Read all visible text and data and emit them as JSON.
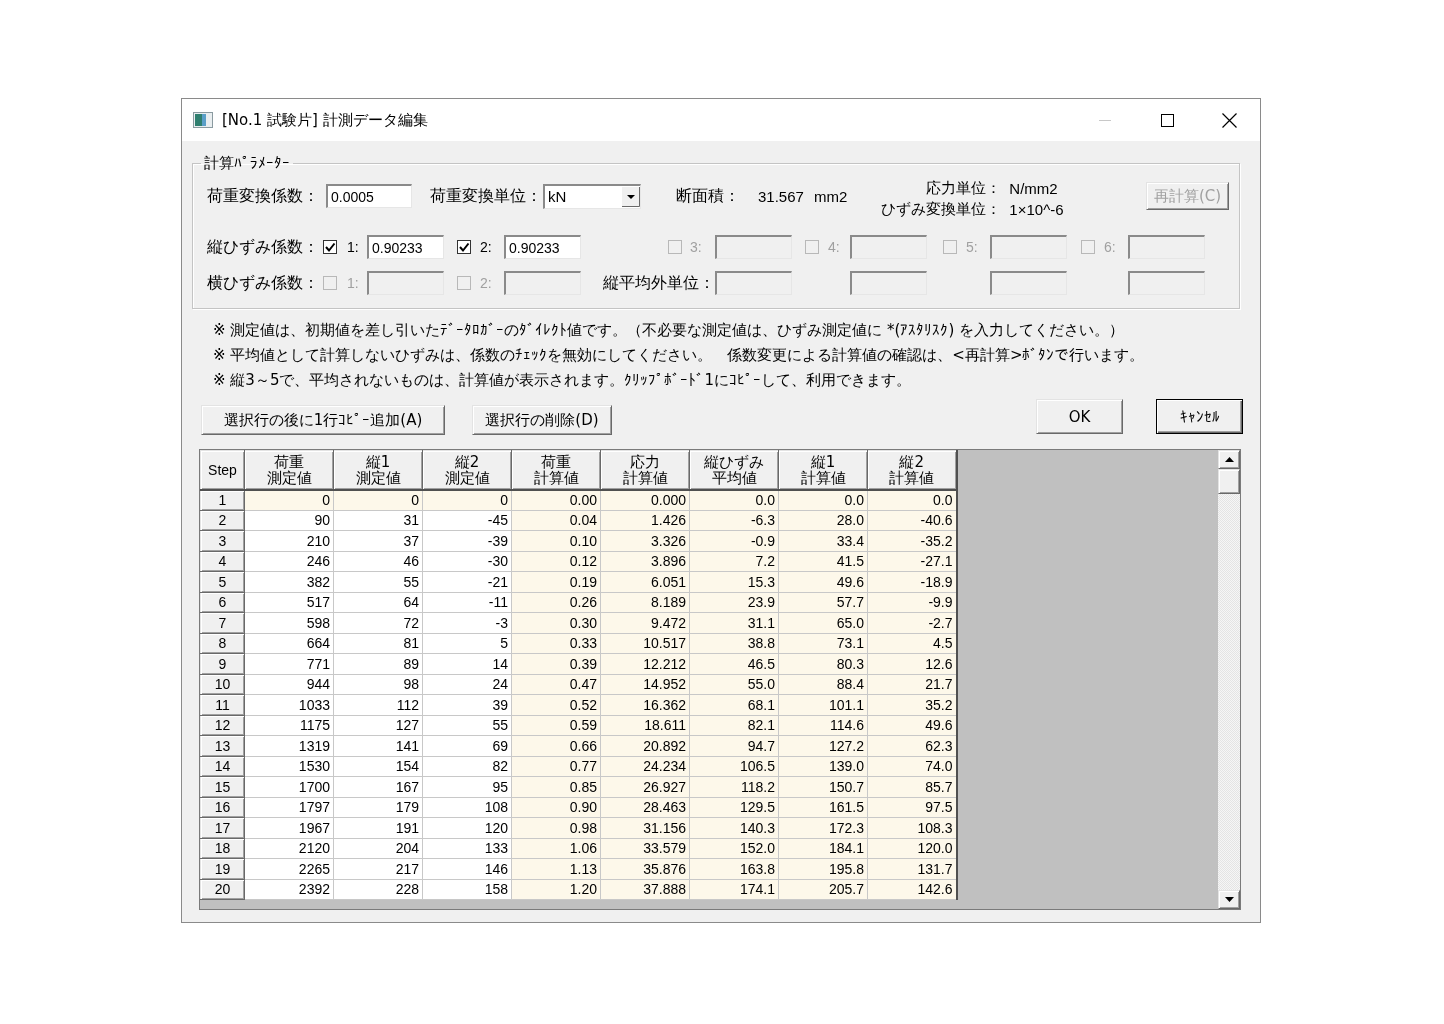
{
  "window": {
    "title": "[No.1 試験片] 計測データ編集",
    "minimize": {
      "disabled": true
    }
  },
  "parameters": {
    "title": "計算ﾊﾟﾗﾒｰﾀｰ",
    "load_factor": {
      "label": "荷重変換係数：",
      "value": "0.0005"
    },
    "load_unit": {
      "label": "荷重変換単位：",
      "value": "kN"
    },
    "area": {
      "label": "断面積：",
      "value": "31.567",
      "unit": "mm2"
    },
    "units": [
      {
        "label": "応力単位：",
        "value": "N/mm2"
      },
      {
        "label": "ひずみ変換単位：",
        "value": "1×10^-6"
      }
    ],
    "recalc_button": {
      "label": "再計算(C)",
      "disabled": true
    },
    "longitudinal": {
      "label": "縦ひずみ係数：",
      "gauges": [
        {
          "number": "1:",
          "checked": true,
          "disabled": false,
          "value": "0.90233"
        },
        {
          "number": "2:",
          "checked": true,
          "disabled": false,
          "value": "0.90233"
        },
        {
          "number": "3:",
          "checked": false,
          "disabled": true
        },
        {
          "number": "4:",
          "checked": false,
          "disabled": true
        },
        {
          "number": "5:",
          "checked": false,
          "disabled": true
        },
        {
          "number": "6:",
          "checked": false,
          "disabled": true
        }
      ]
    },
    "transverse": {
      "label": "横ひずみ係数：",
      "gauges": [
        {
          "number": "1:",
          "checked": false,
          "disabled": true
        },
        {
          "number": "2:",
          "checked": false,
          "disabled": true
        }
      ]
    },
    "non_average_unit": {
      "label": "縦平均外単位：",
      "fields": [
        {
          "disabled": true
        },
        {
          "disabled": true
        },
        {
          "disabled": true
        },
        {
          "disabled": true
        }
      ]
    }
  },
  "notes": [
    "※ 測定値は、初期値を差し引いたﾃﾞｰﾀﾛｶﾞｰのﾀﾞｲﾚｸﾄ値です。（不必要な測定値は、ひずみ測定値に *(ｱｽﾀﾘｽｸ) を入力してください。）",
    "※ 平均値として計算しないひずみは、係数のﾁｪｯｸを無効にしてください。　係数変更による計算値の確認は、<再計算>ﾎﾞﾀﾝで行います。",
    "※ 縦3～5で、平均されないものは、計算値が表示されます。ｸﾘｯﾌﾟﾎﾞｰﾄﾞ1にｺﾋﾟｰして、利用できます。"
  ],
  "row_buttons": [
    "選択行の後に1行ｺﾋﾟｰ追加(A)",
    "選択行の削除(D)"
  ],
  "dialog_buttons": [
    {
      "label": "OK",
      "default": false
    },
    {
      "label": "ｷｬﾝｾﾙ",
      "default": true
    }
  ],
  "table": {
    "step_header": "Step",
    "columns": [
      {
        "lines": [
          "荷重",
          "測定値"
        ],
        "kind": "measured"
      },
      {
        "lines": [
          "縦1",
          "測定値"
        ],
        "kind": "measured"
      },
      {
        "lines": [
          "縦2",
          "測定値"
        ],
        "kind": "measured"
      },
      {
        "lines": [
          "荷重",
          "計算値"
        ],
        "kind": "calculated"
      },
      {
        "lines": [
          "応力",
          "計算値"
        ],
        "kind": "calculated"
      },
      {
        "lines": [
          "縦ひずみ",
          "平均値"
        ],
        "kind": "calculated"
      },
      {
        "lines": [
          "縦1",
          "計算値"
        ],
        "kind": "calculated"
      },
      {
        "lines": [
          "縦2",
          "計算値"
        ],
        "kind": "calculated"
      }
    ],
    "rows": [
      {
        "step": "1",
        "readonly": true,
        "cells": [
          "0",
          "0",
          "0",
          "0.00",
          "0.000",
          "0.0",
          "0.0",
          "0.0"
        ]
      },
      {
        "step": "2",
        "readonly": false,
        "cells": [
          "90",
          "31",
          "-45",
          "0.04",
          "1.426",
          "-6.3",
          "28.0",
          "-40.6"
        ]
      },
      {
        "step": "3",
        "readonly": false,
        "cells": [
          "210",
          "37",
          "-39",
          "0.10",
          "3.326",
          "-0.9",
          "33.4",
          "-35.2"
        ]
      },
      {
        "step": "4",
        "readonly": false,
        "cells": [
          "246",
          "46",
          "-30",
          "0.12",
          "3.896",
          "7.2",
          "41.5",
          "-27.1"
        ]
      },
      {
        "step": "5",
        "readonly": false,
        "cells": [
          "382",
          "55",
          "-21",
          "0.19",
          "6.051",
          "15.3",
          "49.6",
          "-18.9"
        ]
      },
      {
        "step": "6",
        "readonly": false,
        "cells": [
          "517",
          "64",
          "-11",
          "0.26",
          "8.189",
          "23.9",
          "57.7",
          "-9.9"
        ]
      },
      {
        "step": "7",
        "readonly": false,
        "cells": [
          "598",
          "72",
          "-3",
          "0.30",
          "9.472",
          "31.1",
          "65.0",
          "-2.7"
        ]
      },
      {
        "step": "8",
        "readonly": false,
        "cells": [
          "664",
          "81",
          "5",
          "0.33",
          "10.517",
          "38.8",
          "73.1",
          "4.5"
        ]
      },
      {
        "step": "9",
        "readonly": false,
        "cells": [
          "771",
          "89",
          "14",
          "0.39",
          "12.212",
          "46.5",
          "80.3",
          "12.6"
        ]
      },
      {
        "step": "10",
        "readonly": false,
        "cells": [
          "944",
          "98",
          "24",
          "0.47",
          "14.952",
          "55.0",
          "88.4",
          "21.7"
        ]
      },
      {
        "step": "11",
        "readonly": false,
        "cells": [
          "1033",
          "112",
          "39",
          "0.52",
          "16.362",
          "68.1",
          "101.1",
          "35.2"
        ]
      },
      {
        "step": "12",
        "readonly": false,
        "cells": [
          "1175",
          "127",
          "55",
          "0.59",
          "18.611",
          "82.1",
          "114.6",
          "49.6"
        ]
      },
      {
        "step": "13",
        "readonly": false,
        "cells": [
          "1319",
          "141",
          "69",
          "0.66",
          "20.892",
          "94.7",
          "127.2",
          "62.3"
        ]
      },
      {
        "step": "14",
        "readonly": false,
        "cells": [
          "1530",
          "154",
          "82",
          "0.77",
          "24.234",
          "106.5",
          "139.0",
          "74.0"
        ]
      },
      {
        "step": "15",
        "readonly": false,
        "cells": [
          "1700",
          "167",
          "95",
          "0.85",
          "26.927",
          "118.2",
          "150.7",
          "85.7"
        ]
      },
      {
        "step": "16",
        "readonly": false,
        "cells": [
          "1797",
          "179",
          "108",
          "0.90",
          "28.463",
          "129.5",
          "161.5",
          "97.5"
        ]
      },
      {
        "step": "17",
        "readonly": false,
        "cells": [
          "1967",
          "191",
          "120",
          "0.98",
          "31.156",
          "140.3",
          "172.3",
          "108.3"
        ]
      },
      {
        "step": "18",
        "readonly": false,
        "cells": [
          "2120",
          "204",
          "133",
          "1.06",
          "33.579",
          "152.0",
          "184.1",
          "120.0"
        ]
      },
      {
        "step": "19",
        "readonly": false,
        "cells": [
          "2265",
          "217",
          "146",
          "1.13",
          "35.876",
          "163.8",
          "195.8",
          "131.7"
        ]
      },
      {
        "step": "20",
        "readonly": false,
        "cells": [
          "2392",
          "228",
          "158",
          "1.20",
          "37.888",
          "174.1",
          "205.7",
          "142.6"
        ]
      }
    ]
  }
}
